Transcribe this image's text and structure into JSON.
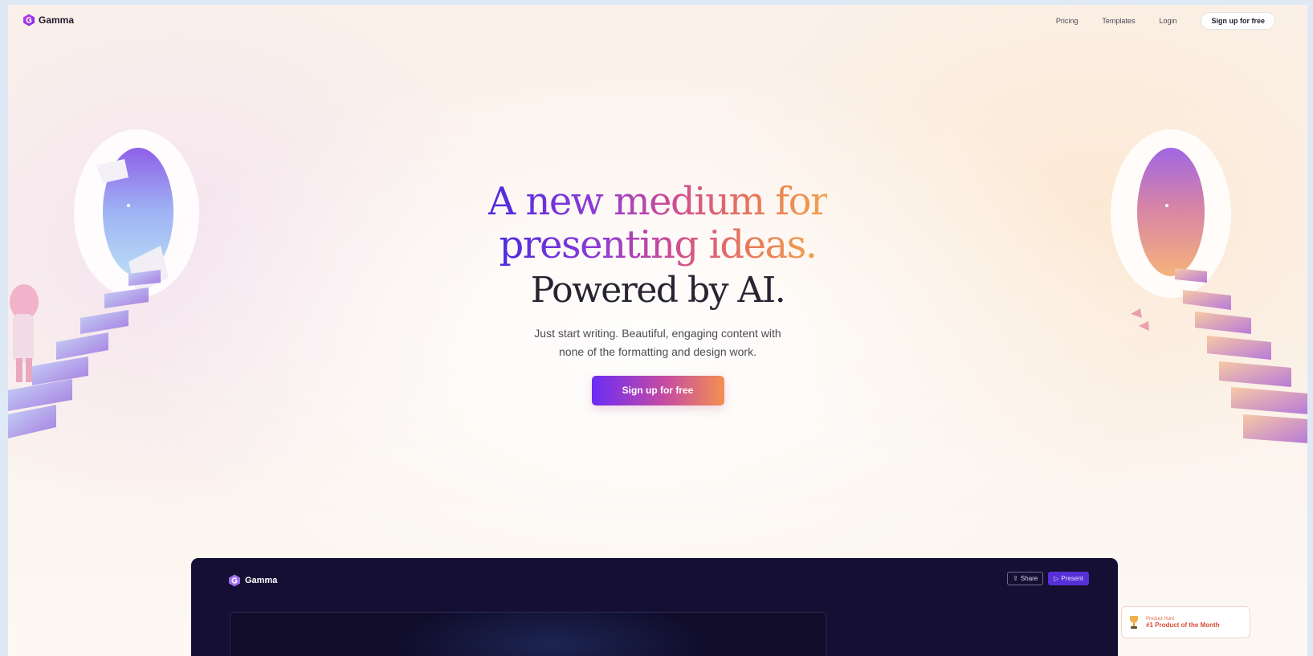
{
  "nav": {
    "brand": "Gamma",
    "links": [
      "Pricing",
      "Templates",
      "Login"
    ],
    "cta": "Sign up for free"
  },
  "hero": {
    "headline_line1": "A new medium for",
    "headline_line2": "presenting ideas.",
    "subhead": "Powered by AI.",
    "desc_line1": "Just start writing. Beautiful, engaging content with",
    "desc_line2": "none of the formatting and design work.",
    "cta": "Sign up for free"
  },
  "demo": {
    "brand": "Gamma",
    "share": "Share",
    "present": "Present"
  },
  "badge": {
    "small": "Product Hunt",
    "title": "#1 Product of the Month"
  },
  "colors": {
    "accent": "#6b2cf5",
    "gradient_end": "#f39052",
    "dark_panel": "#151033"
  },
  "icons": {
    "logo": "gamma-logo-icon",
    "share": "share-icon",
    "present": "play-icon",
    "badge": "trophy-icon"
  }
}
